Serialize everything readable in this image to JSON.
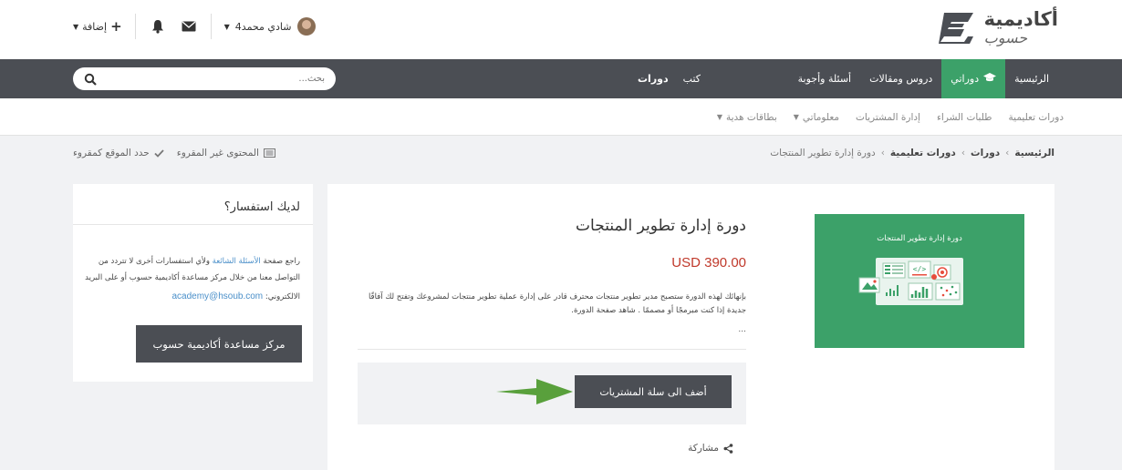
{
  "header": {
    "logo_main": "أكاديمية",
    "logo_sub": "حسوب",
    "add_label": "إضافة",
    "user_name": "شادي محمد4",
    "icons": [
      "bell-icon",
      "envelope-icon",
      "plus-icon",
      "avatar"
    ]
  },
  "mainnav": {
    "items": [
      {
        "label": "الرئيسية"
      },
      {
        "label": "دوراتي",
        "icon": "graduation-cap-icon",
        "active": true
      },
      {
        "label": "دروس ومقالات"
      },
      {
        "label": "أسئلة وأجوبة"
      },
      {
        "label": "كتب"
      },
      {
        "label": "دورات"
      }
    ],
    "search_placeholder": "بحث..."
  },
  "subnav": {
    "items": [
      {
        "label": "دورات تعليمية"
      },
      {
        "label": "طلبات الشراء"
      },
      {
        "label": "إدارة المشتريات"
      },
      {
        "label": "معلوماتي"
      },
      {
        "label": "بطاقات هدية"
      }
    ]
  },
  "breadcrumb": {
    "items": [
      "الرئيسية",
      "دورات",
      "دورات تعليمية",
      "دورة إدارة تطوير المنتجات"
    ],
    "actions": {
      "unread": "المحتوى غير المقروء",
      "mark_read": "حدد الموقع كمقروء"
    }
  },
  "product": {
    "cover_title": "دورة إدارة تطوير المنتجات",
    "title": "دورة إدارة تطوير المنتجات",
    "price": "USD 390.00",
    "description": "بإنهائك لهذه الدورة ستصبح مدير تطوير منتجات محترف قادر على إدارة عملية تطوير منتجات لمشروعك وتفتح لك آفاقًا جديدة إذا كنت مبرمجًا أو مصممًا . شاهد صفحة الدورة.",
    "more": "...",
    "cart_button": "أضف الى سلة المشتريات",
    "share": "مشاركة",
    "accent": "#3ca169",
    "price_color": "#c0392b"
  },
  "sidebar": {
    "title": "لديك استفسار؟",
    "text_before": "راجع صفحة ",
    "link": "الأسئلة الشائعة",
    "text_after": " ولأي استفسارات أخرى لا تتردد من التواصل معنا من خلال مركز مساعدة أكاديمية حسوب أو على البريد الالكتروني: ",
    "email": "academy@hsoub.com",
    "button": "مركز مساعدة أكاديمية حسوب"
  }
}
